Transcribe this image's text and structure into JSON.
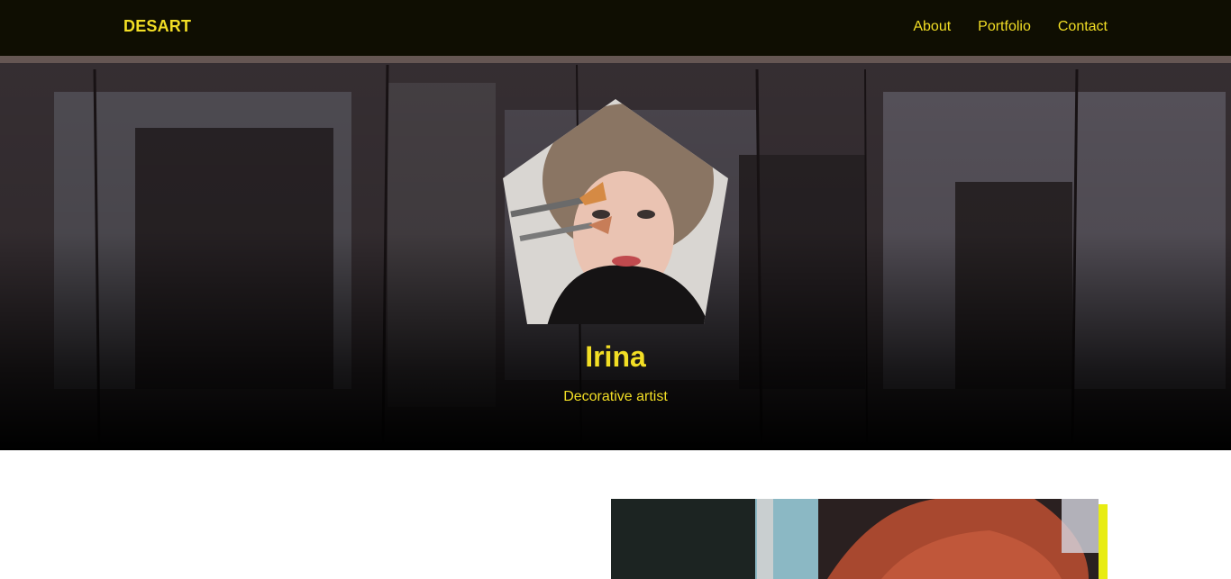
{
  "header": {
    "brand": "DESART",
    "nav": [
      {
        "label": "About"
      },
      {
        "label": "Portfolio"
      },
      {
        "label": "Contact"
      }
    ]
  },
  "hero": {
    "name": "Irina",
    "role": "Decorative artist"
  },
  "colors": {
    "accent": "#f2de25",
    "topbar": "#0f0e02",
    "stripe": "#e8ec12"
  }
}
